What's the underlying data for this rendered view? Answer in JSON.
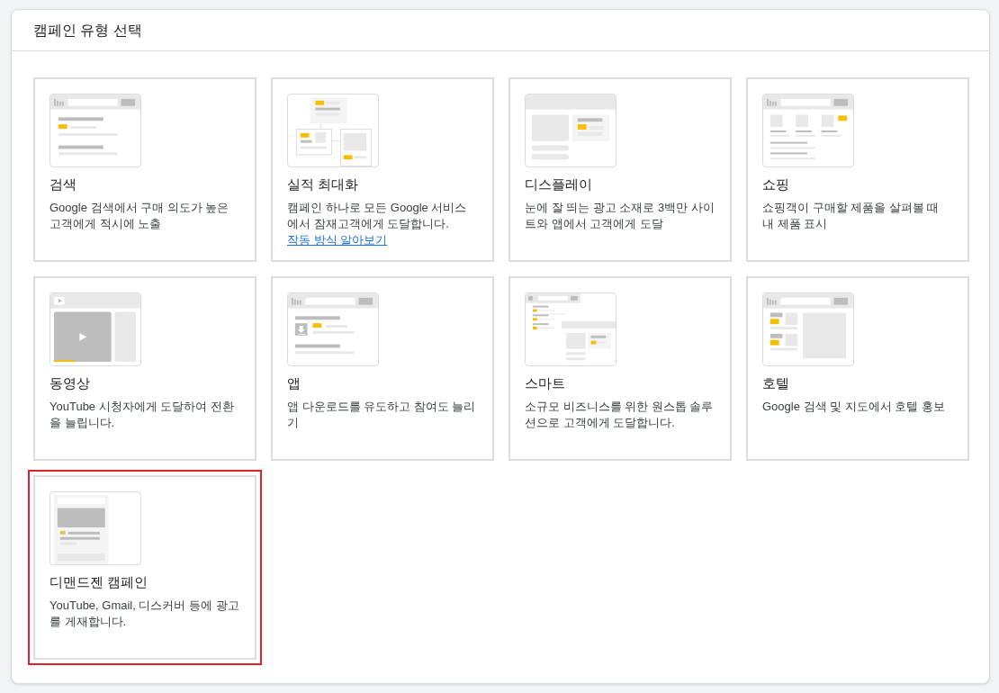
{
  "panel": {
    "title": "캠페인 유형 선택"
  },
  "campaign_types": [
    {
      "kind": "search",
      "title": "검색",
      "description": "Google 검색에서 구매 의도가 높은 고객에게 적시에 노출",
      "selected": false
    },
    {
      "kind": "performance_max",
      "title": "실적 최대화",
      "description": "캠페인 하나로 모든 Google 서비스에서 잠재고객에게 도달합니다.",
      "link": "작동 방식 알아보기",
      "selected": false
    },
    {
      "kind": "display",
      "title": "디스플레이",
      "description": "눈에 잘 띄는 광고 소재로 3백만 사이트와 앱에서 고객에게 도달",
      "selected": false
    },
    {
      "kind": "shopping",
      "title": "쇼핑",
      "description": "쇼핑객이 구매할 제품을 살펴볼 때 내 제품 표시",
      "selected": false
    },
    {
      "kind": "video",
      "title": "동영상",
      "description": "YouTube 시청자에게 도달하여 전환을 늘립니다.",
      "selected": false
    },
    {
      "kind": "app",
      "title": "앱",
      "description": "앱 다운로드를 유도하고 참여도 늘리기",
      "selected": false
    },
    {
      "kind": "smart",
      "title": "스마트",
      "description": "소규모 비즈니스를 위한 원스톱 솔루션으로 고객에게 도달합니다.",
      "selected": false
    },
    {
      "kind": "hotel",
      "title": "호텔",
      "description": "Google 검색 및 지도에서 호텔 홍보",
      "selected": false
    },
    {
      "kind": "discovery",
      "title": "디맨드젠 캠페인",
      "description": "YouTube, Gmail, 디스커버 등에 광고를 게재합니다.",
      "selected": true
    }
  ]
}
